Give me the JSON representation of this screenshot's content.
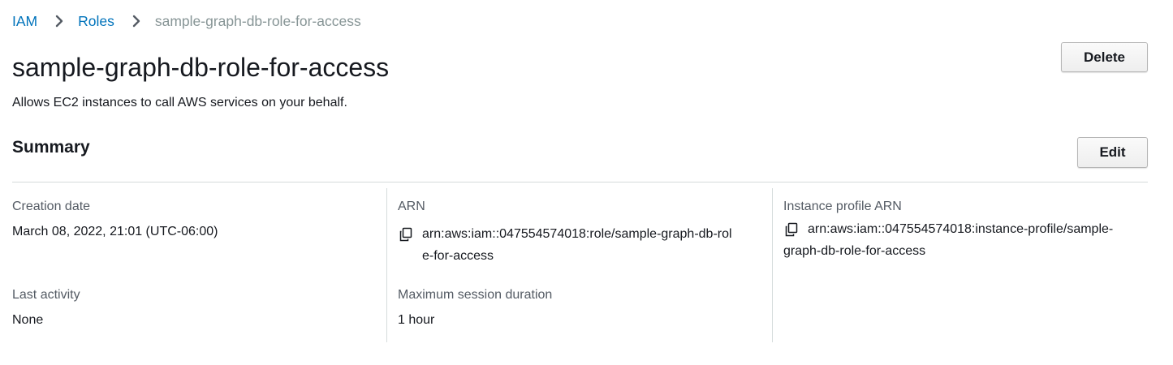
{
  "breadcrumb": {
    "items": [
      "IAM",
      "Roles"
    ],
    "current": "sample-graph-db-role-for-access"
  },
  "header": {
    "title": "sample-graph-db-role-for-access",
    "description": "Allows EC2 instances to call AWS services on your behalf.",
    "delete_label": "Delete"
  },
  "summary": {
    "title": "Summary",
    "edit_label": "Edit",
    "creation_date": {
      "label": "Creation date",
      "value": "March 08, 2022, 21:01 (UTC-06:00)"
    },
    "last_activity": {
      "label": "Last activity",
      "value": "None"
    },
    "arn": {
      "label": "ARN",
      "line1": "arn:aws:iam::047554574018:role/sample-graph-db-rol",
      "line2": "e-for-access"
    },
    "max_session": {
      "label": "Maximum session duration",
      "value": "1 hour"
    },
    "instance_profile_arn": {
      "label": "Instance profile ARN",
      "line1": "arn:aws:iam::047554574018:instance-profile/sample-",
      "line2": "graph-db-role-for-access"
    }
  },
  "icons": {
    "separator": "chevron-right-icon",
    "copy": "copy-icon"
  },
  "colors": {
    "link": "#0073bb",
    "current_crumb": "#879596",
    "label": "#545b64",
    "divider": "#d5dbdb"
  }
}
